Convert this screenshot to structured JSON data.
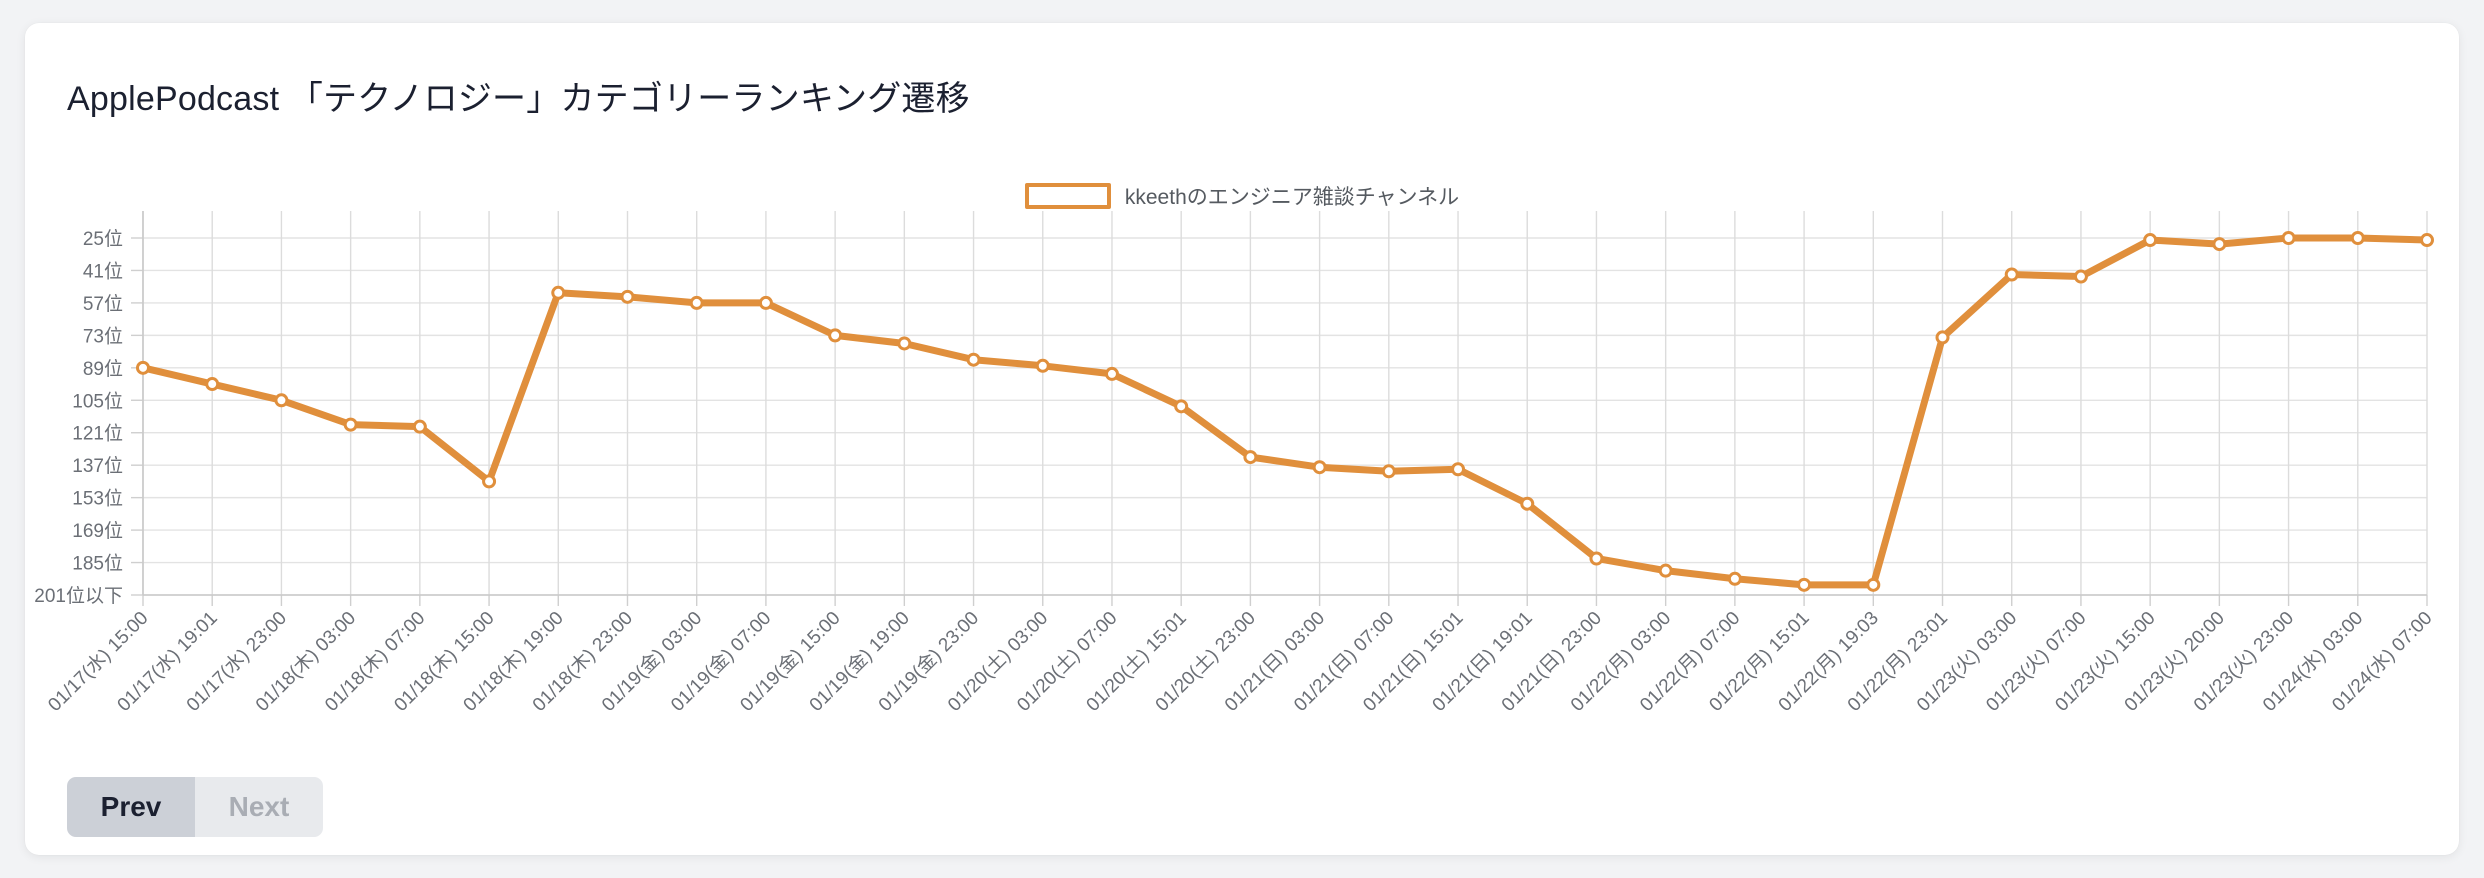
{
  "card": {
    "title": "ApplePodcast 「テクノロジー」カテゴリーランキング遷移"
  },
  "pager": {
    "prev_label": "Prev",
    "next_label": "Next"
  },
  "colors": {
    "series": "#e08f3c",
    "grid": "#e3e3e3",
    "text": "#6b6f76",
    "title": "#1b2030",
    "card_background": "#ffffff",
    "page_background": "#f2f3f5",
    "prev_button": "#ccd0d7",
    "next_button": "#e8eaed"
  },
  "chart_data": {
    "type": "line",
    "title": "ApplePodcast 「テクノロジー」カテゴリーランキング遷移",
    "xlabel": "",
    "ylabel": "",
    "grid": true,
    "legend_position": "top-center",
    "y_inverted": true,
    "ytick_labels": [
      "25位",
      "41位",
      "57位",
      "73位",
      "89位",
      "105位",
      "121位",
      "137位",
      "153位",
      "169位",
      "185位",
      "201位以下"
    ],
    "ytick_values": [
      25,
      41,
      57,
      73,
      89,
      105,
      121,
      137,
      153,
      169,
      185,
      201
    ],
    "ylim": [
      25,
      201
    ],
    "categories": [
      "01/17(水) 15:00",
      "01/17(水) 19:01",
      "01/17(水) 23:00",
      "01/18(木) 03:00",
      "01/18(木) 07:00",
      "01/18(木) 15:00",
      "01/18(木) 19:00",
      "01/18(木) 23:00",
      "01/19(金) 03:00",
      "01/19(金) 07:00",
      "01/19(金) 15:00",
      "01/19(金) 19:00",
      "01/19(金) 23:00",
      "01/20(土) 03:00",
      "01/20(土) 07:00",
      "01/20(土) 15:01",
      "01/20(土) 23:00",
      "01/21(日) 03:00",
      "01/21(日) 07:00",
      "01/21(日) 15:01",
      "01/21(日) 19:01",
      "01/21(日) 23:00",
      "01/22(月) 03:00",
      "01/22(月) 07:00",
      "01/22(月) 15:01",
      "01/22(月) 19:03",
      "01/22(月) 23:01",
      "01/23(火) 03:00",
      "01/23(火) 07:00",
      "01/23(火) 15:00",
      "01/23(火) 20:00",
      "01/23(火) 23:00",
      "01/24(水) 03:00",
      "01/24(水) 07:00"
    ],
    "series": [
      {
        "name": "kkeethのエンジニア雑談チャンネル",
        "color": "#e08f3c",
        "values": [
          89,
          97,
          105,
          117,
          118,
          145,
          52,
          54,
          57,
          57,
          73,
          77,
          85,
          88,
          92,
          108,
          133,
          138,
          140,
          139,
          156,
          183,
          189,
          193,
          196,
          196,
          74,
          43,
          44,
          26,
          28,
          24,
          25,
          26
        ]
      }
    ]
  }
}
